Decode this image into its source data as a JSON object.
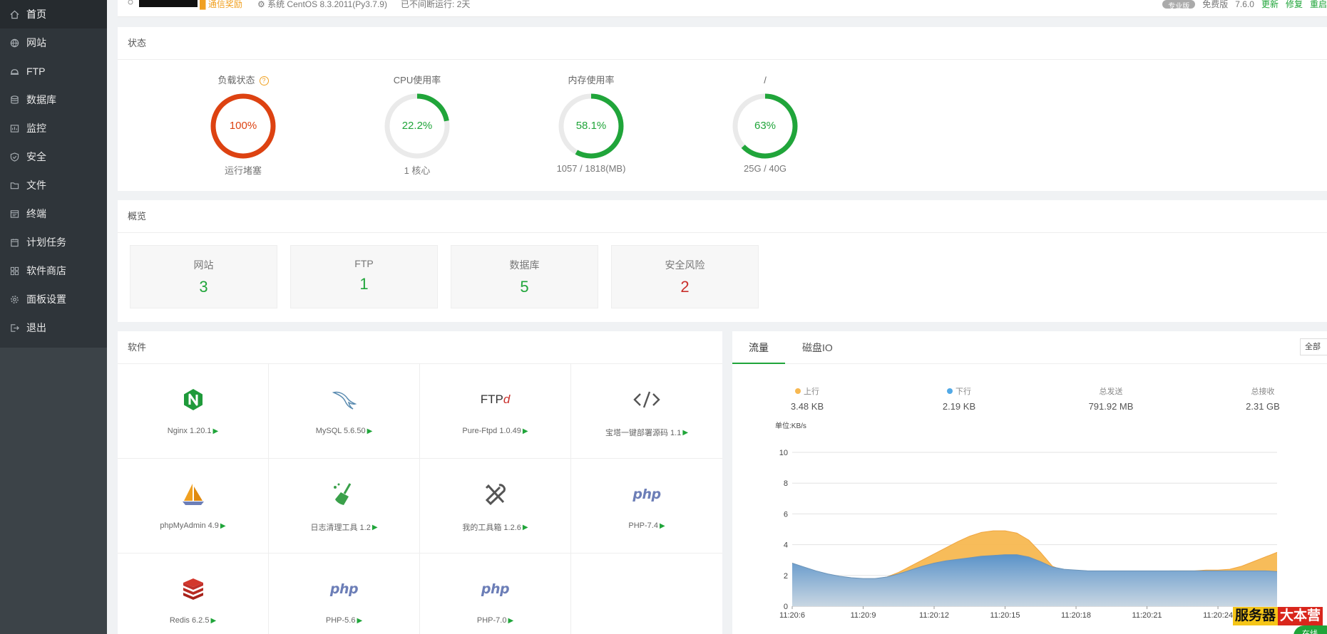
{
  "sidebar": {
    "items": [
      {
        "label": "首页",
        "icon": "home-icon"
      },
      {
        "label": "网站",
        "icon": "globe-icon"
      },
      {
        "label": "FTP",
        "icon": "ftp-icon"
      },
      {
        "label": "数据库",
        "icon": "database-icon"
      },
      {
        "label": "监控",
        "icon": "monitor-icon"
      },
      {
        "label": "安全",
        "icon": "shield-icon"
      },
      {
        "label": "文件",
        "icon": "folder-icon"
      },
      {
        "label": "终端",
        "icon": "terminal-icon"
      },
      {
        "label": "计划任务",
        "icon": "calendar-icon"
      },
      {
        "label": "软件商店",
        "icon": "apps-icon"
      },
      {
        "label": "面板设置",
        "icon": "gear-icon"
      },
      {
        "label": "退出",
        "icon": "logout-icon"
      }
    ]
  },
  "topbar": {
    "badge": "█ 通信奖励",
    "system": "⚙ 系统    CentOS 8.3.2011(Py3.7.9)",
    "uptime": "已不间断运行: 2天",
    "edition_pill": "专业版",
    "edition": "免费版",
    "version": "7.6.0",
    "update": "更新",
    "repair": "修复",
    "restart": "重启"
  },
  "status": {
    "title": "状态",
    "gauges": [
      {
        "title": "负载状态",
        "value": "100%",
        "percent": 100,
        "sub": "运行堵塞",
        "color": "#dd4211",
        "help": "?"
      },
      {
        "title": "CPU使用率",
        "value": "22.2%",
        "percent": 22.2,
        "sub": "1 核心",
        "color": "#20a53a"
      },
      {
        "title": "内存使用率",
        "value": "58.1%",
        "percent": 58.1,
        "sub": "1057 / 1818(MB)",
        "color": "#20a53a"
      },
      {
        "title": "/",
        "value": "63%",
        "percent": 63,
        "sub": "25G / 40G",
        "color": "#20a53a"
      }
    ]
  },
  "overview": {
    "title": "概览",
    "boxes": [
      {
        "label": "网站",
        "count": "3"
      },
      {
        "label": "FTP",
        "count": "1"
      },
      {
        "label": "数据库",
        "count": "5"
      },
      {
        "label": "安全风险",
        "count": "2"
      }
    ]
  },
  "software": {
    "title": "软件",
    "items": [
      {
        "name": "Nginx 1.20.1",
        "icon": "nginx-icon"
      },
      {
        "name": "MySQL 5.6.50",
        "icon": "mysql-dolphin-icon"
      },
      {
        "name": "Pure-Ftpd 1.0.49",
        "icon": "ftpd-icon"
      },
      {
        "name": "宝塔一键部署源码 1.1",
        "icon": "code-icon"
      },
      {
        "name": "phpMyAdmin 4.9",
        "icon": "sailboat-icon"
      },
      {
        "name": "日志清理工具 1.2",
        "icon": "broom-icon"
      },
      {
        "name": "我的工具箱 1.2.6",
        "icon": "tools-icon"
      },
      {
        "name": "PHP-7.4",
        "icon": "php-icon"
      },
      {
        "name": "Redis 6.2.5",
        "icon": "redis-icon"
      },
      {
        "name": "PHP-5.6",
        "icon": "php-icon"
      },
      {
        "name": "PHP-7.0",
        "icon": "php-icon"
      }
    ],
    "play": "▶",
    "ftp_logo": "FTP",
    "php_logo": "php"
  },
  "traffic": {
    "tabs": [
      "流量",
      "磁盘IO"
    ],
    "select": "全部",
    "stats": [
      {
        "label": "上行",
        "value": "3.48 KB",
        "dot": "#f7b851"
      },
      {
        "label": "下行",
        "value": "2.19 KB",
        "dot": "#52a9e6"
      },
      {
        "label": "总发送",
        "value": "791.92 MB"
      },
      {
        "label": "总接收",
        "value": "2.31 GB"
      }
    ]
  },
  "chart_data": {
    "type": "area",
    "ylabel": "单位:KB/s",
    "ylim": [
      0,
      10
    ],
    "yticks": [
      0,
      2,
      4,
      6,
      8,
      10
    ],
    "xticks": [
      "11:20:6",
      "11:20:9",
      "11:20:12",
      "11:20:15",
      "11:20:18",
      "11:20:21",
      "11:20:24"
    ],
    "x": [
      6,
      6.5,
      7,
      7.5,
      8,
      8.5,
      9,
      9.5,
      10,
      10.5,
      11,
      11.5,
      12,
      12.5,
      13,
      13.5,
      14,
      14.5,
      15,
      15.5,
      16,
      16.5,
      17,
      17.5,
      18,
      18.5,
      19,
      19.5,
      20,
      20.5,
      21,
      21.5,
      22,
      22.5,
      23,
      23.5,
      24,
      24.5,
      25,
      25.5,
      26,
      26.5
    ],
    "series": [
      {
        "name": "上行",
        "color": "#f7b851",
        "values": [
          2.8,
          2.5,
          2.2,
          2.0,
          1.85,
          1.75,
          1.7,
          1.75,
          1.9,
          2.2,
          2.6,
          3.0,
          3.4,
          3.8,
          4.2,
          4.55,
          4.8,
          4.9,
          4.9,
          4.75,
          4.3,
          3.5,
          2.6,
          2.3,
          2.25,
          2.2,
          2.2,
          2.2,
          2.2,
          2.25,
          2.25,
          2.25,
          2.3,
          2.3,
          2.3,
          2.35,
          2.35,
          2.4,
          2.6,
          2.9,
          3.2,
          3.5
        ]
      },
      {
        "name": "下行",
        "color": "#52a9e6",
        "values": [
          2.8,
          2.55,
          2.3,
          2.1,
          1.95,
          1.85,
          1.8,
          1.8,
          1.9,
          2.1,
          2.35,
          2.6,
          2.8,
          2.95,
          3.05,
          3.15,
          3.25,
          3.3,
          3.35,
          3.35,
          3.2,
          2.9,
          2.55,
          2.4,
          2.35,
          2.3,
          2.3,
          2.3,
          2.3,
          2.3,
          2.3,
          2.3,
          2.3,
          2.3,
          2.3,
          2.3,
          2.3,
          2.3,
          2.3,
          2.3,
          2.3,
          2.25
        ]
      }
    ]
  },
  "watermark": {
    "part1": "服务器",
    "part2": "大本营"
  },
  "online": "在线"
}
